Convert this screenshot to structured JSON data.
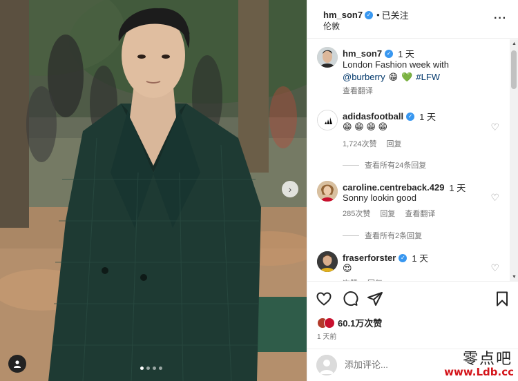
{
  "post": {
    "username": "hm_son7",
    "separator": "•",
    "follow_state": "已关注",
    "location": "伦敦",
    "more_icon": "more-horizontal-icon"
  },
  "media": {
    "slide_count": 4,
    "active_slide": 1,
    "next_icon": "chevron-right-icon",
    "tag_icon": "user-tag-icon"
  },
  "caption": {
    "username": "hm_son7",
    "time": "1 天",
    "line1": "London Fashion week with",
    "mention": "@burberry",
    "emoji": "😁",
    "heart": "💚",
    "hashtag": "#LFW",
    "translate": "查看翻译"
  },
  "comments": [
    {
      "username": "adidasfootball",
      "verified": true,
      "time": "1 天",
      "text": "😁 😁 😁 😁",
      "likes": "1,724次赞",
      "reply": "回复",
      "view_replies": "查看所有24条回复"
    },
    {
      "username": "caroline.centreback.429",
      "verified": false,
      "time": "1 天",
      "text": "Sonny lookin good",
      "likes": "285次赞",
      "reply": "回复",
      "translate": "查看翻译",
      "view_replies": "查看所有2条回复"
    },
    {
      "username": "fraserforster",
      "verified": true,
      "time": "1 天",
      "text": "😍",
      "likes": "次赞",
      "reply": "回复"
    }
  ],
  "actions": {
    "like_icon": "heart-icon",
    "comment_icon": "comment-icon",
    "share_icon": "send-icon",
    "save_icon": "bookmark-icon",
    "likes_count": "60.1万次赞",
    "post_time": "1 天前"
  },
  "add_comment": {
    "placeholder": "添加评论..."
  },
  "watermark": {
    "cn": "零点吧",
    "url": "www.Ldb.cc"
  },
  "colors": {
    "verified": "#3897f0",
    "link": "#00376b",
    "watermark_red": "#d4141a"
  }
}
